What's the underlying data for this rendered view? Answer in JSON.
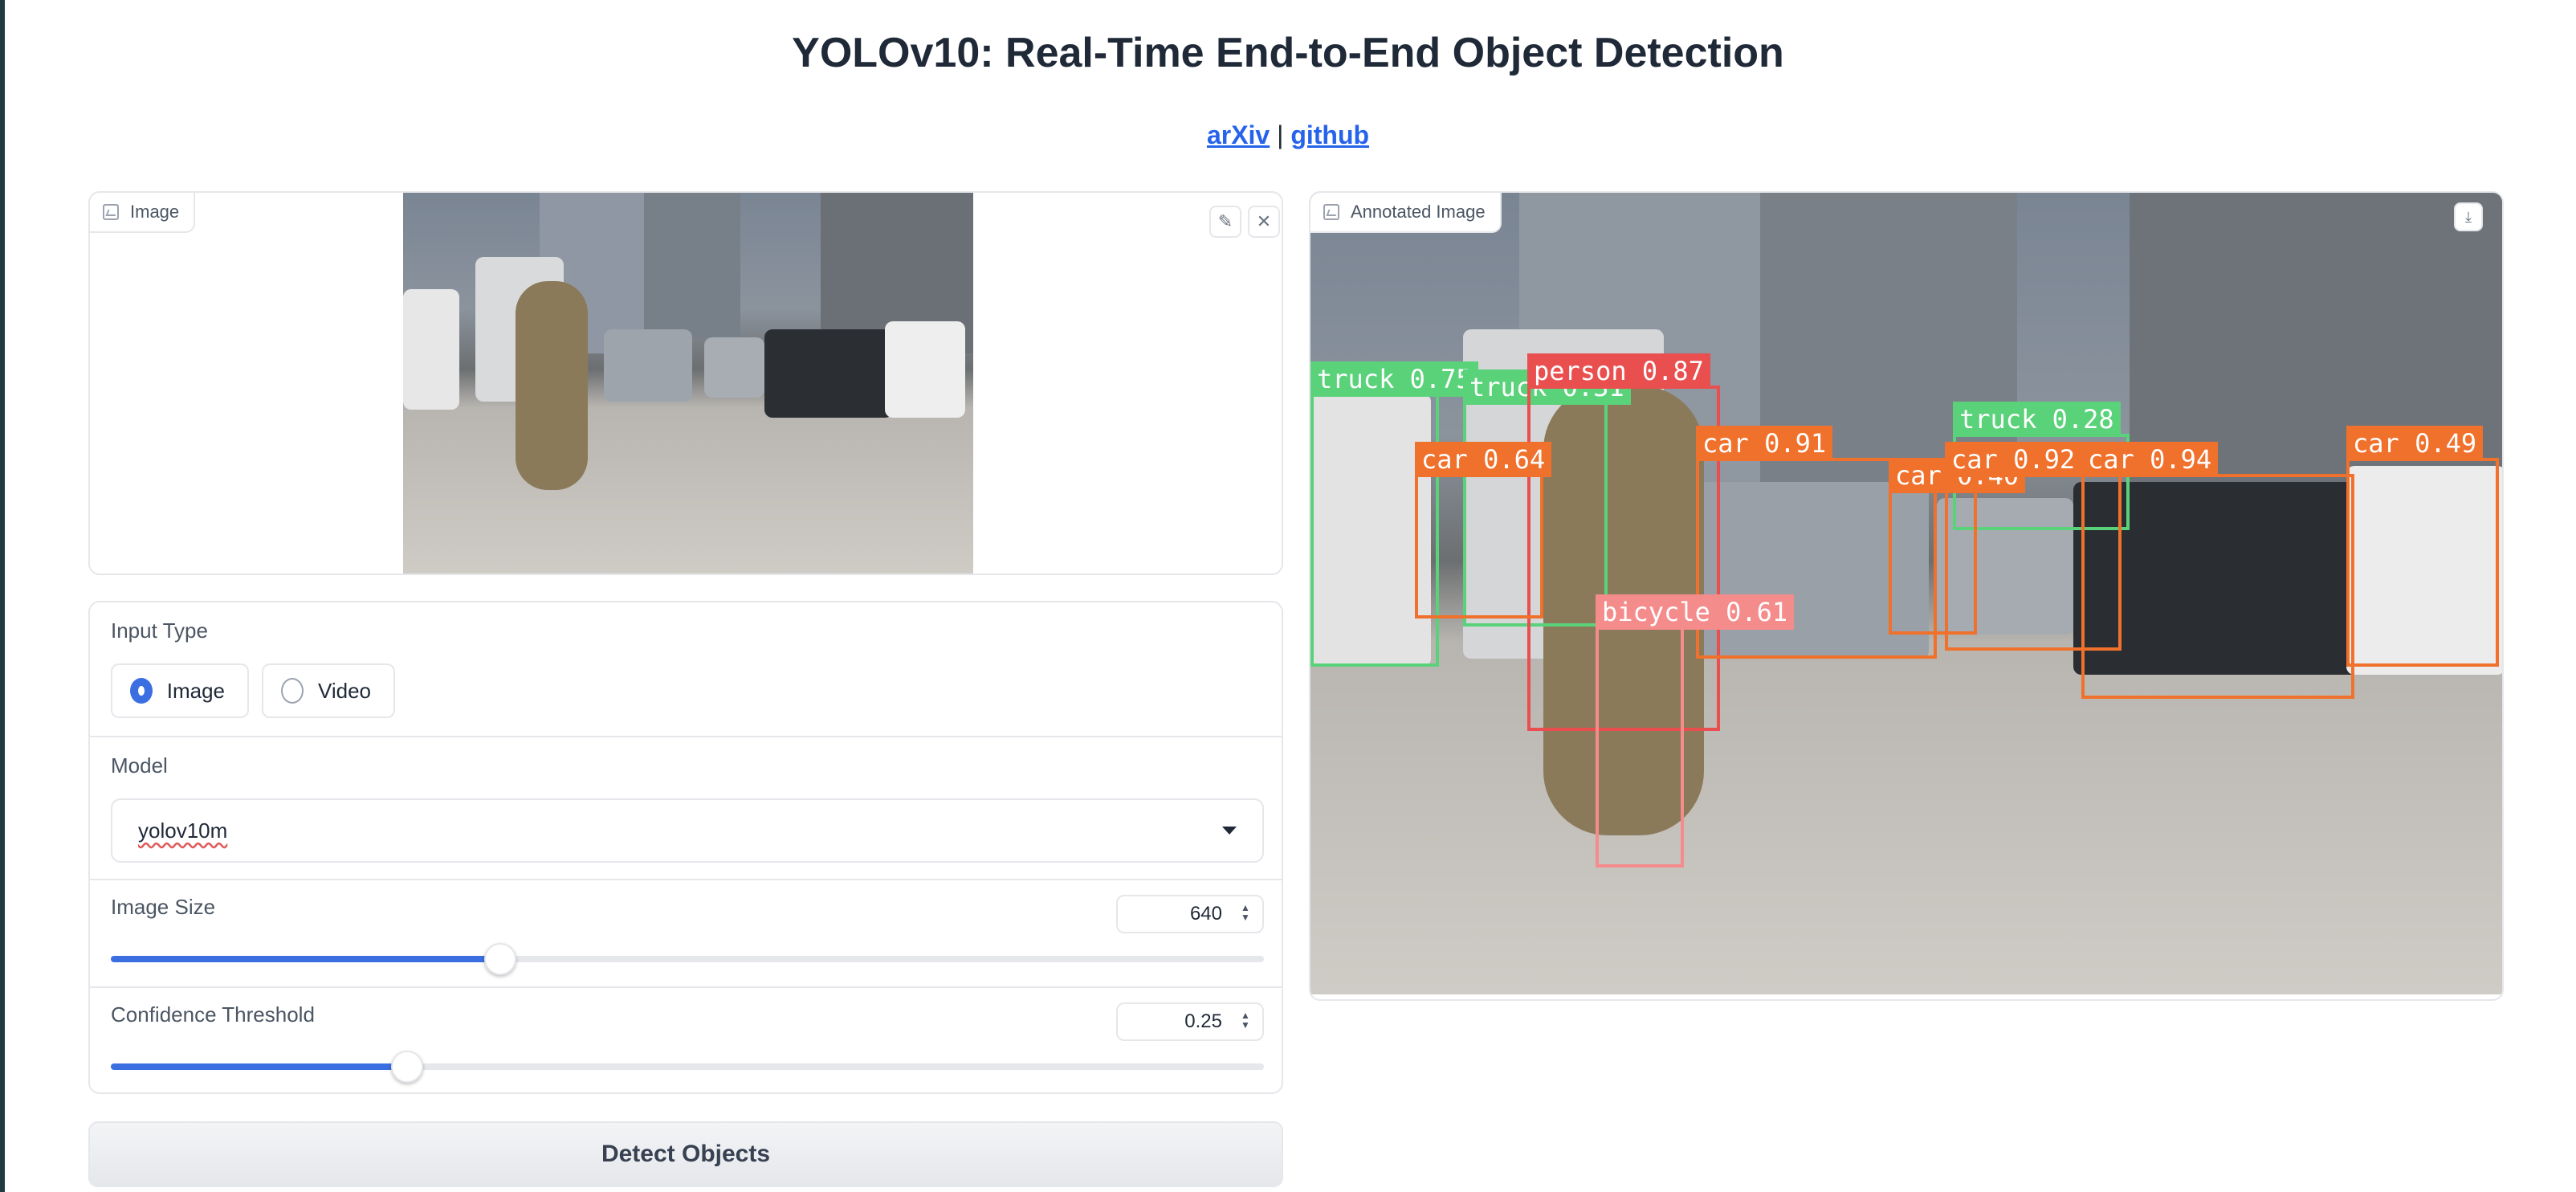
{
  "header": {
    "title": "YOLOv10: Real-Time End-to-End Object Detection",
    "link_arxiv": "arXiv",
    "separator": "|",
    "link_github": "github"
  },
  "input_image": {
    "label": "Image",
    "icon": "image-icon",
    "actions": [
      "edit-icon",
      "close-icon"
    ]
  },
  "output_image": {
    "label": "Annotated Image",
    "icon": "image-icon",
    "actions": [
      "download-icon"
    ],
    "detections": [
      {
        "label": "truck 0.75",
        "color": "#5ad27a"
      },
      {
        "label": "truck 0.31",
        "color": "#5ad27a"
      },
      {
        "label": "person 0.87",
        "color": "#ea4f4f"
      },
      {
        "label": "car 0.64",
        "color": "#f0712c"
      },
      {
        "label": "car 0.91",
        "color": "#f0712c"
      },
      {
        "label": "truck 0.28",
        "color": "#5ad27a"
      },
      {
        "label": "car 0.40",
        "color": "#f0712c"
      },
      {
        "label": "car 0.92",
        "color": "#f0712c"
      },
      {
        "label": "car 0.94",
        "color": "#f0712c"
      },
      {
        "label": "car 0.49",
        "color": "#f0712c"
      },
      {
        "label": "bicycle 0.61",
        "color": "#f58c8c"
      }
    ]
  },
  "form": {
    "input_type": {
      "label": "Input Type",
      "options": [
        "Image",
        "Video"
      ],
      "selected": "Image"
    },
    "model": {
      "label": "Model",
      "value": "yolov10m"
    },
    "image_size": {
      "label": "Image Size",
      "value": "640",
      "fraction": 0.338
    },
    "confidence": {
      "label": "Confidence Threshold",
      "value": "0.25",
      "fraction": 0.257
    }
  },
  "actions": {
    "detect_label": "Detect Objects"
  },
  "colors": {
    "accent": "#3b6ee0",
    "link": "#2563eb",
    "border": "#e5e7eb"
  }
}
